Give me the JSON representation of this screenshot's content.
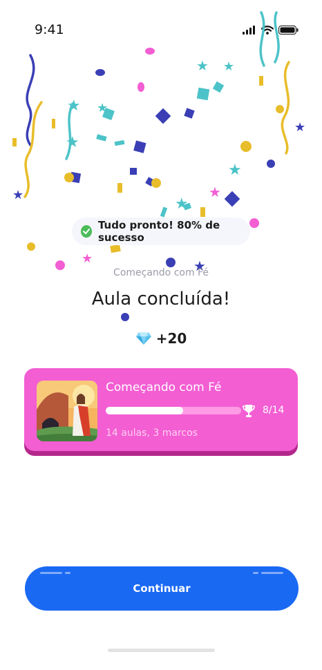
{
  "status_bar": {
    "time": "9:41"
  },
  "toast": {
    "text": "Tudo pronto! 80% de sucesso",
    "icon": "check-circle-icon"
  },
  "lesson": {
    "course": "Começando com Fé",
    "title": "Aula concluída!"
  },
  "reward": {
    "icon": "diamond-gem-icon",
    "value": "+20"
  },
  "course_card": {
    "title": "Começando com Fé",
    "progress_text": "8/14",
    "progress_fraction": 0.57,
    "meta": "14 aulas, 3 marcos",
    "image": "jesus-empty-tomb-illustration",
    "trophy_icon": "trophy-icon",
    "color": "#f35ed3"
  },
  "cta": {
    "label": "Continuar",
    "color": "#1a69f3"
  },
  "colors": {
    "success": "#4cbb5a"
  }
}
